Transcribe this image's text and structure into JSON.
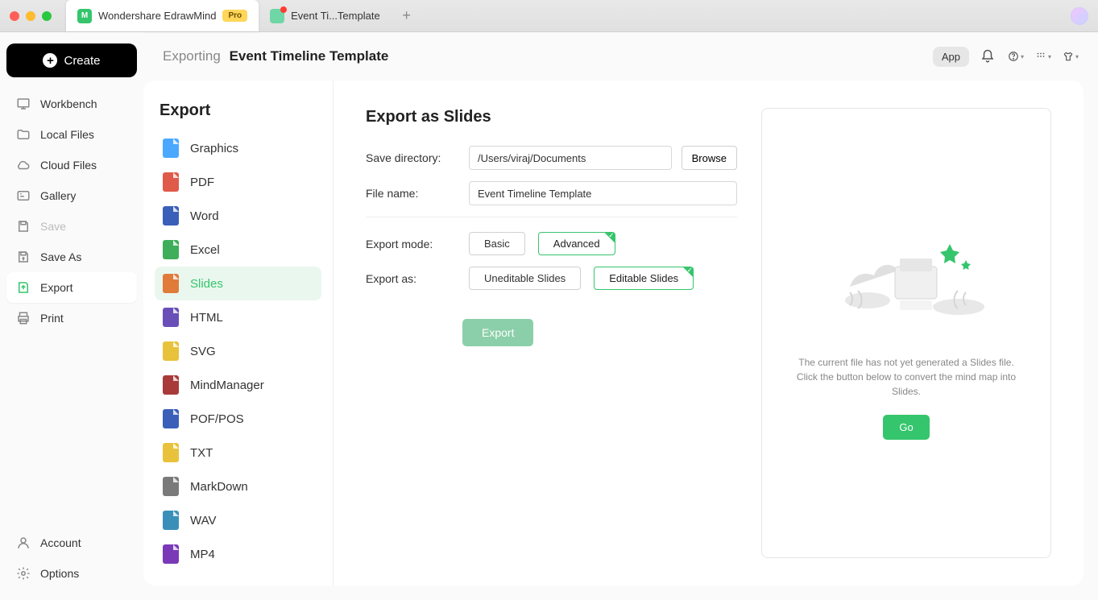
{
  "titlebar": {
    "app_tab": "Wondershare EdrawMind",
    "pro_badge": "Pro",
    "doc_tab": "Event Ti...Template"
  },
  "sidebar": {
    "create": "Create",
    "items": [
      "Workbench",
      "Local Files",
      "Cloud Files",
      "Gallery",
      "Save",
      "Save As",
      "Export",
      "Print"
    ],
    "account": "Account",
    "options": "Options"
  },
  "topbar": {
    "crumb_prefix": "Exporting",
    "crumb_doc": "Event Timeline Template",
    "app_chip": "App"
  },
  "export_list": {
    "title": "Export",
    "formats": [
      "Graphics",
      "PDF",
      "Word",
      "Excel",
      "Slides",
      "HTML",
      "SVG",
      "MindManager",
      "POF/POS",
      "TXT",
      "MarkDown",
      "WAV",
      "MP4"
    ]
  },
  "form": {
    "title": "Export as Slides",
    "save_dir_label": "Save directory:",
    "save_dir_value": "/Users/viraj/Documents",
    "browse": "Browse",
    "file_name_label": "File name:",
    "file_name_value": "Event Timeline Template",
    "mode_label": "Export mode:",
    "mode_basic": "Basic",
    "mode_advanced": "Advanced",
    "as_label": "Export as:",
    "as_uneditable": "Uneditable Slides",
    "as_editable": "Editable Slides",
    "export_btn": "Export"
  },
  "preview": {
    "text": "The current file has not yet generated a Slides file. Click the button below to convert the mind map into Slides.",
    "go": "Go"
  }
}
